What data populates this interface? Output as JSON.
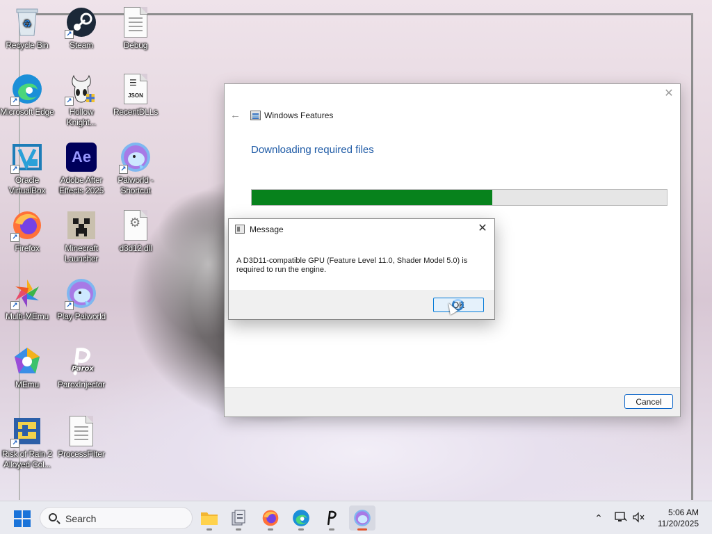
{
  "desktop": {
    "icons": [
      {
        "name": "recycle-bin-desktop-icon",
        "label": "Recycle Bin"
      },
      {
        "name": "steam-desktop-icon",
        "label": "Steam"
      },
      {
        "name": "debug-file-desktop-icon",
        "label": "Debug"
      },
      {
        "name": "microsoft-edge-desktop-icon",
        "label": "Microsoft Edge"
      },
      {
        "name": "hollow-knight-desktop-icon",
        "label": "Hollow Knight..."
      },
      {
        "name": "recentdlls-file-desktop-icon",
        "label": "RecentDLLs",
        "badge": "JSON"
      },
      {
        "name": "oracle-virtualbox-desktop-icon",
        "label": "Oracle VirtualBox"
      },
      {
        "name": "adobe-after-effects-desktop-icon",
        "label": "Adobe After Effects 2025",
        "badge": "Ae"
      },
      {
        "name": "palworld-shortcut-desktop-icon",
        "label": "Palworld - Shortcut"
      },
      {
        "name": "firefox-desktop-icon",
        "label": "Firefox"
      },
      {
        "name": "minecraft-launcher-desktop-icon",
        "label": "Minecraft Launcher"
      },
      {
        "name": "d3d12-dll-desktop-icon",
        "label": "d3d12.dll"
      },
      {
        "name": "multi-memu-desktop-icon",
        "label": "Multi-MEmu"
      },
      {
        "name": "play-palworld-desktop-icon",
        "label": "Play Palworld"
      },
      {
        "name": "memu-desktop-icon",
        "label": "MEmu"
      },
      {
        "name": "paroxinjector-desktop-icon",
        "label": "ParoxInjector",
        "badge": "Parox"
      },
      {
        "name": "risk-of-rain-2-desktop-icon",
        "label": "Risk of Rain 2 Alloyed Col..."
      },
      {
        "name": "processfilter-desktop-icon",
        "label": "ProcessFilter"
      }
    ]
  },
  "windows_features": {
    "title": "Windows Features",
    "heading": "Downloading required files",
    "progress": 0.58,
    "cancel_label": "Cancel",
    "close_glyph": "✕",
    "back_glyph": "←"
  },
  "message_box": {
    "title": "Message",
    "text": "A D3D11-compatible GPU (Feature Level 11.0, Shader Model 5.0) is required to run the engine.",
    "ok_label": "OK",
    "close_glyph": "✕"
  },
  "taskbar": {
    "search_placeholder": "Search",
    "time": "5:06 AM",
    "date": "11/20/2025",
    "apps": [
      "file-explorer",
      "file-manager",
      "firefox",
      "microsoft-edge",
      "parox",
      "palworld"
    ],
    "active_app": "palworld",
    "accent_color": "#1a73d9"
  }
}
